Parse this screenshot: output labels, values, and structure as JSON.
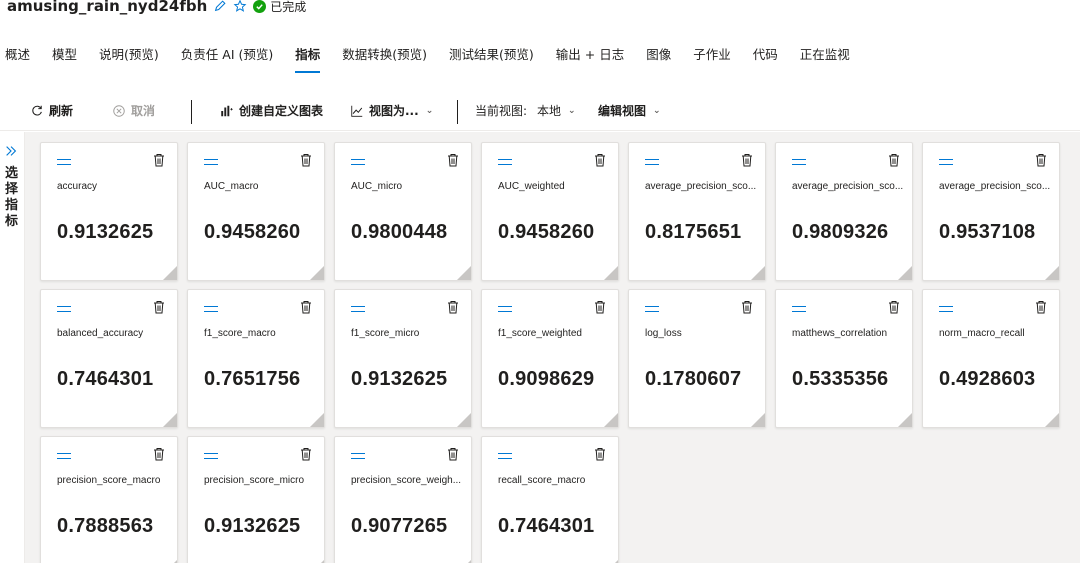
{
  "header": {
    "title": "amusing_rain_nyd24fbh",
    "status": "已完成"
  },
  "tabs": [
    {
      "label": "概述"
    },
    {
      "label": "模型"
    },
    {
      "label": "说明(预览)"
    },
    {
      "label": "负责任 AI (预览)"
    },
    {
      "label": "指标",
      "active": true
    },
    {
      "label": "数据转换(预览)"
    },
    {
      "label": "测试结果(预览)"
    },
    {
      "label": "输出 + 日志"
    },
    {
      "label": "图像"
    },
    {
      "label": "子作业"
    },
    {
      "label": "代码"
    },
    {
      "label": "正在监视"
    }
  ],
  "toolbar": {
    "refresh": "刷新",
    "cancel": "取消",
    "create_chart": "创建自定义图表",
    "view_as": "视图为...",
    "current_view_label": "当前视图:",
    "current_view_value": "本地",
    "edit_view": "编辑视图"
  },
  "sidebar": {
    "label": "选择指标"
  },
  "metrics": [
    {
      "name": "accuracy",
      "value": "0.9132625"
    },
    {
      "name": "AUC_macro",
      "value": "0.9458260"
    },
    {
      "name": "AUC_micro",
      "value": "0.9800448"
    },
    {
      "name": "AUC_weighted",
      "value": "0.9458260"
    },
    {
      "name": "average_precision_sco...",
      "value": "0.8175651"
    },
    {
      "name": "average_precision_sco...",
      "value": "0.9809326"
    },
    {
      "name": "average_precision_sco...",
      "value": "0.9537108"
    },
    {
      "name": "balanced_accuracy",
      "value": "0.7464301"
    },
    {
      "name": "f1_score_macro",
      "value": "0.7651756"
    },
    {
      "name": "f1_score_micro",
      "value": "0.9132625"
    },
    {
      "name": "f1_score_weighted",
      "value": "0.9098629"
    },
    {
      "name": "log_loss",
      "value": "0.1780607"
    },
    {
      "name": "matthews_correlation",
      "value": "0.5335356"
    },
    {
      "name": "norm_macro_recall",
      "value": "0.4928603"
    },
    {
      "name": "precision_score_macro",
      "value": "0.7888563"
    },
    {
      "name": "precision_score_micro",
      "value": "0.9132625"
    },
    {
      "name": "precision_score_weigh...",
      "value": "0.9077265"
    },
    {
      "name": "recall_score_macro",
      "value": "0.7464301"
    }
  ],
  "colors": {
    "accent": "#0078d4",
    "success": "#13a10e"
  },
  "icons": [
    "pencil-icon",
    "star-icon",
    "check-circle-icon",
    "refresh-icon",
    "cancel-icon",
    "bar-chart-icon",
    "line-chart-icon",
    "chevron-down-icon",
    "double-chevron-right-icon",
    "drag-handle-icon",
    "trash-icon"
  ]
}
